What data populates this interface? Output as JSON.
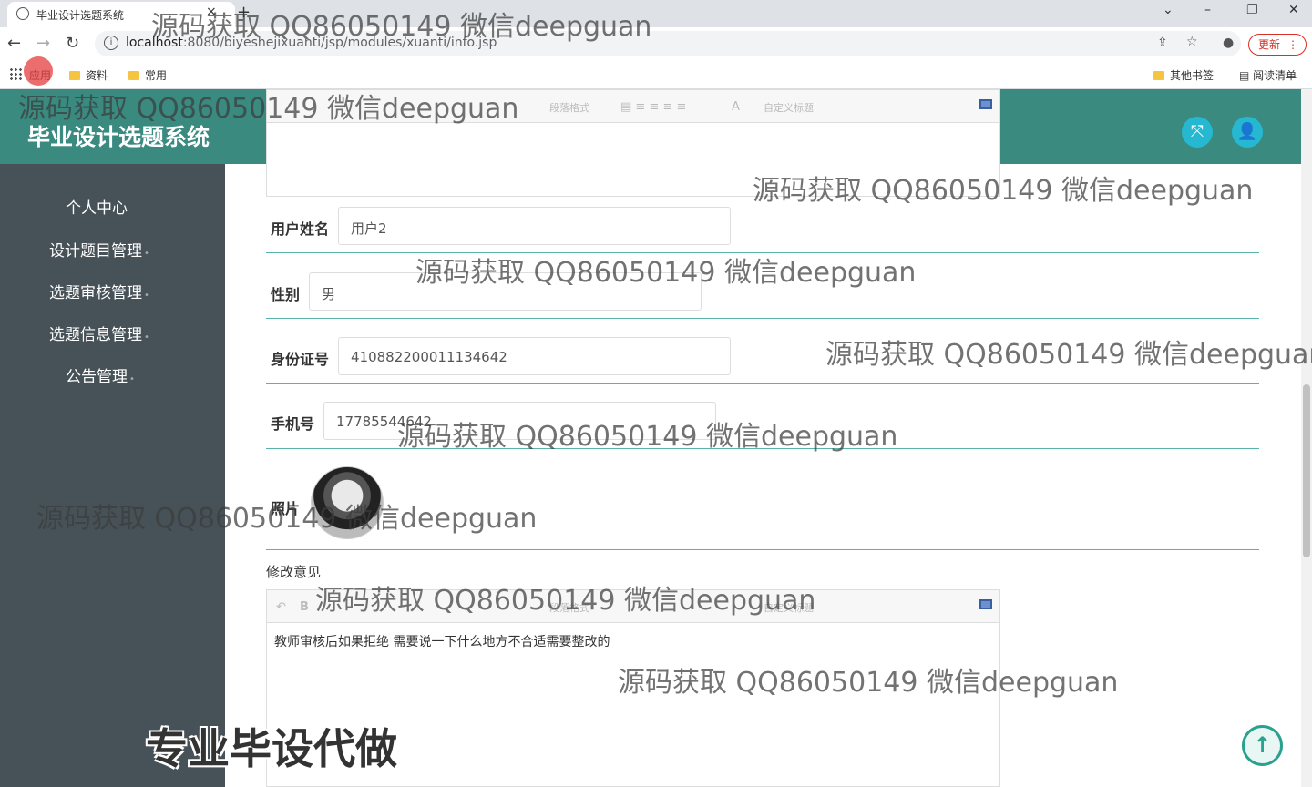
{
  "browser": {
    "tab_title": "毕业设计选题系统",
    "url_host": "localhost",
    "url_rest": ":8080/biyeshejixuanti/jsp/modules/xuanti/info.jsp",
    "update_label": "更新",
    "bookmarks": [
      "应用",
      "资料",
      "常用"
    ],
    "bookmarks_right": [
      "其他书签",
      "阅读清单"
    ]
  },
  "app": {
    "title": "毕业设计选题系统"
  },
  "sidebar": {
    "items": [
      {
        "label": "个人中心"
      },
      {
        "label": "设计题目管理"
      },
      {
        "label": "选题审核管理"
      },
      {
        "label": "选题信息管理"
      },
      {
        "label": "公告管理"
      }
    ]
  },
  "editor_toolbar": {
    "paragraph": "段落格式",
    "custom_title": "自定义标题",
    "font_a": "A"
  },
  "form": {
    "username_label": "用户姓名",
    "username_value": "用户2",
    "gender_label": "性别",
    "gender_value": "男",
    "idcard_label": "身份证号",
    "idcard_value": "410882200011134642",
    "phone_label": "手机号",
    "phone_value": "17785544642",
    "photo_label": "照片",
    "revise_label": "修改意见",
    "revise_text": "教师审核后如果拒绝 需要说一下什么地方不合适需要整改的"
  },
  "overlay": {
    "watermark": "源码获取 QQ86050149 微信deepguan",
    "promo": "专业毕设代做"
  }
}
